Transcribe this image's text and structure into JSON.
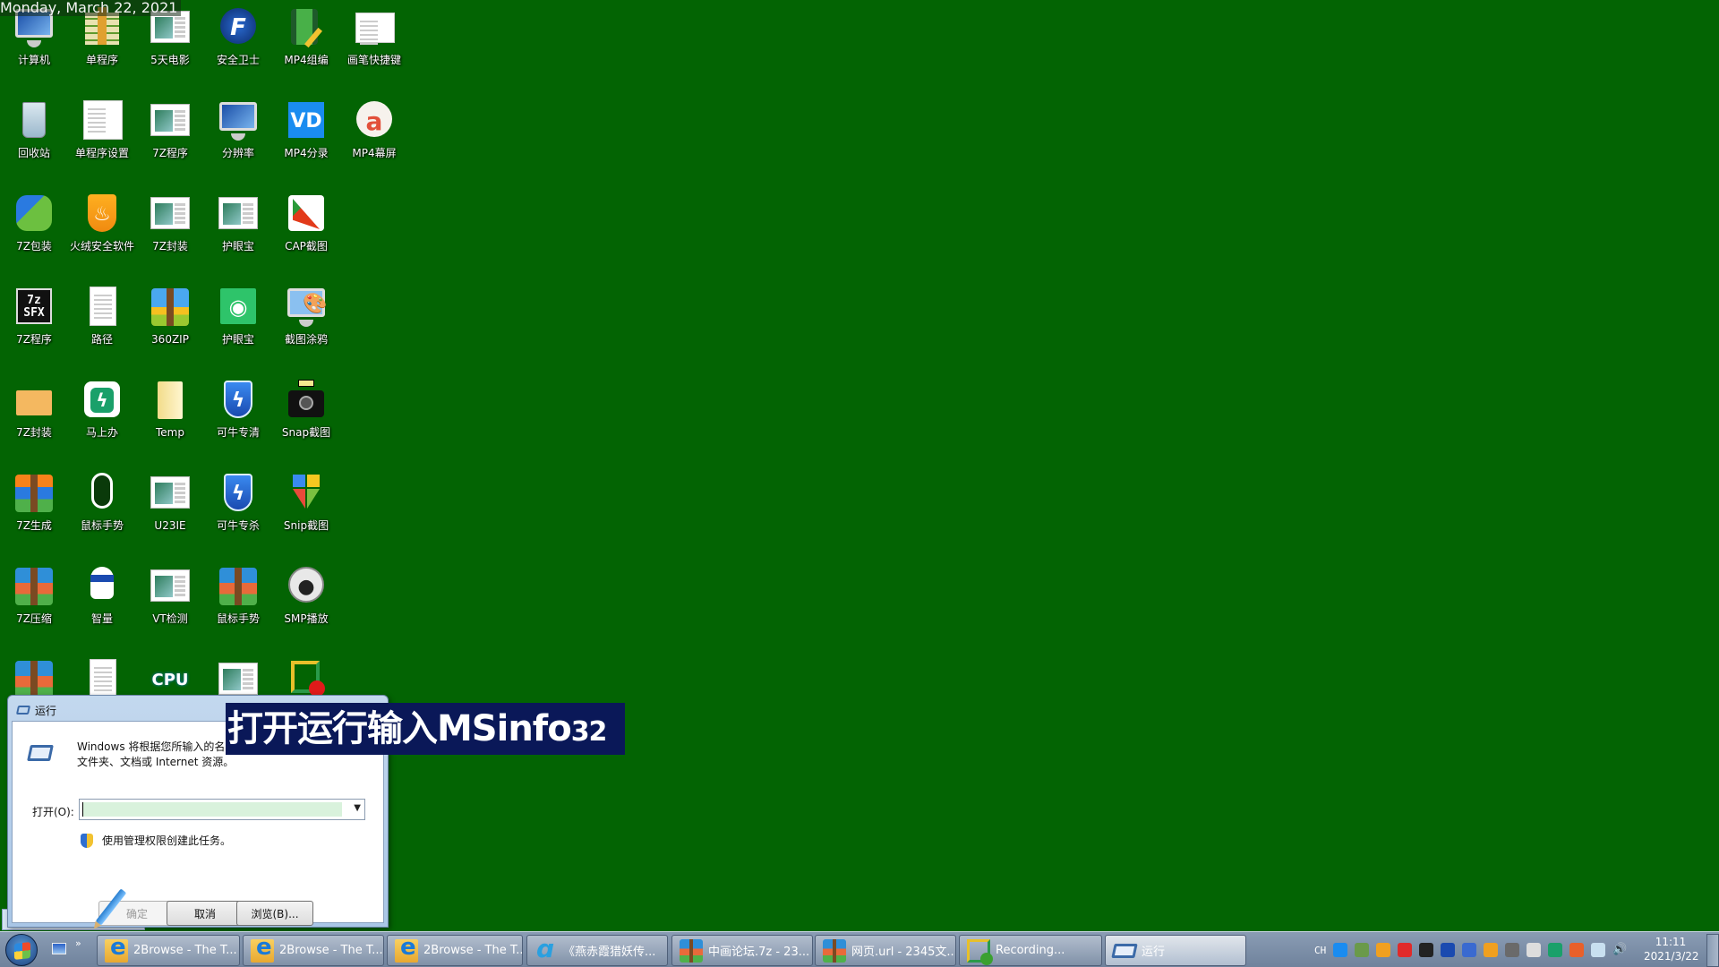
{
  "date_banner": "Monday, March 22, 2021",
  "desktop_icons": [
    {
      "label": "计算机",
      "icon": "computer-icon"
    },
    {
      "label": "单程序",
      "icon": "archive-books-icon"
    },
    {
      "label": "5天电影",
      "icon": "app-window-icon"
    },
    {
      "label": "安全卫士",
      "icon": "security-guard-icon"
    },
    {
      "label": "MP4组编",
      "icon": "video-edit-icon"
    },
    {
      "label": "画笔快捷键",
      "icon": "screenshot-thumbnail-icon"
    },
    {
      "label": "回收站",
      "icon": "recycle-bin-icon"
    },
    {
      "label": "单程序设置",
      "icon": "document-icon"
    },
    {
      "label": "7Z程序",
      "icon": "app-window-icon"
    },
    {
      "label": "分辨率",
      "icon": "display-icon"
    },
    {
      "label": "MP4分录",
      "icon": "vd-icon"
    },
    {
      "label": "MP4幕屏",
      "icon": "screen-recorder-icon"
    },
    {
      "label": "7Z包装",
      "icon": "puzzle-icon"
    },
    {
      "label": "火绒安全软件",
      "icon": "huorong-shield-icon"
    },
    {
      "label": "7Z封装",
      "icon": "app-window-icon"
    },
    {
      "label": "护眼宝",
      "icon": "app-window-icon"
    },
    {
      "label": "CAP截图",
      "icon": "cap-screenshot-icon"
    },
    {
      "label": "7Z程序",
      "icon": "sfx-icon"
    },
    {
      "label": "路径",
      "icon": "text-file-icon"
    },
    {
      "label": "360ZIP",
      "icon": "zip-icon"
    },
    {
      "label": "护眼宝",
      "icon": "eye-icon"
    },
    {
      "label": "截图涂鸦",
      "icon": "paint-icon"
    },
    {
      "label": "7Z封装",
      "icon": "box-icon"
    },
    {
      "label": "马上办",
      "icon": "lightning-app-icon"
    },
    {
      "label": "Temp",
      "icon": "folder-icon"
    },
    {
      "label": "可牛专清",
      "icon": "lightning-shield-icon"
    },
    {
      "label": "Snap截图",
      "icon": "camera-icon"
    },
    {
      "label": "7Z生成",
      "icon": "archive-icon"
    },
    {
      "label": "鼠标手势",
      "icon": "mouse-icon"
    },
    {
      "label": "U23IE",
      "icon": "app-window-icon"
    },
    {
      "label": "可牛专杀",
      "icon": "lightning-shield-icon"
    },
    {
      "label": "Snip截图",
      "icon": "snip-icon"
    },
    {
      "label": "7Z压缩",
      "icon": "winrar-icon"
    },
    {
      "label": "智量",
      "icon": "robot-icon"
    },
    {
      "label": "VT检测",
      "icon": "app-window-icon"
    },
    {
      "label": "鼠标手势",
      "icon": "winrar-icon"
    },
    {
      "label": "SMP播放",
      "icon": "media-player-icon"
    },
    {
      "label": "",
      "icon": "winrar-icon"
    },
    {
      "label": "",
      "icon": "text-file-icon"
    },
    {
      "label": "",
      "icon": "cpu-icon"
    },
    {
      "label": "",
      "icon": "app-window-icon"
    },
    {
      "label": "",
      "icon": "recording-icon"
    }
  ],
  "run_dialog": {
    "title": "运行",
    "description_line1": "Windows 将根据您所输入的名称",
    "description_line2": "文件夹、文档或 Internet 资源。",
    "open_label": "打开(O):",
    "open_value": "",
    "admin_note": "使用管理权限创建此任务。",
    "ok_label": "确定",
    "cancel_label": "取消",
    "browse_label": "浏览(B)..."
  },
  "caption": {
    "text": "打开运行输入MSinfo",
    "suffix": "32"
  },
  "taskbar": {
    "tasks": [
      {
        "label": "2Browse - The T...",
        "icon": "ie"
      },
      {
        "label": "2Browse - The T...",
        "icon": "ie"
      },
      {
        "label": "2Browse - The T...",
        "icon": "ie"
      },
      {
        "label": "《燕赤霞猎妖传...",
        "icon": "cloud"
      },
      {
        "label": "中画论坛.7z - 23...",
        "icon": "zip"
      },
      {
        "label": "网页.url - 2345文...",
        "icon": "zip"
      },
      {
        "label": "Recording...",
        "icon": "rec"
      },
      {
        "label": "运行",
        "icon": "run"
      }
    ],
    "tray": {
      "language": "CH",
      "icons": [
        "qq-icon",
        "recorder-tray-icon",
        "snip-tray-icon",
        "cap-tray-icon",
        "camera-tray-icon",
        "robot-tray-icon",
        "usb-icon",
        "huorong-tray-icon",
        "device-ok-icon",
        "mouse-tray-icon",
        "lightning-tray-icon",
        "paw-tray-icon",
        "cloud-sync-icon",
        "volume-icon"
      ]
    },
    "clock_time": "11:11",
    "clock_date": "2021/3/22"
  }
}
